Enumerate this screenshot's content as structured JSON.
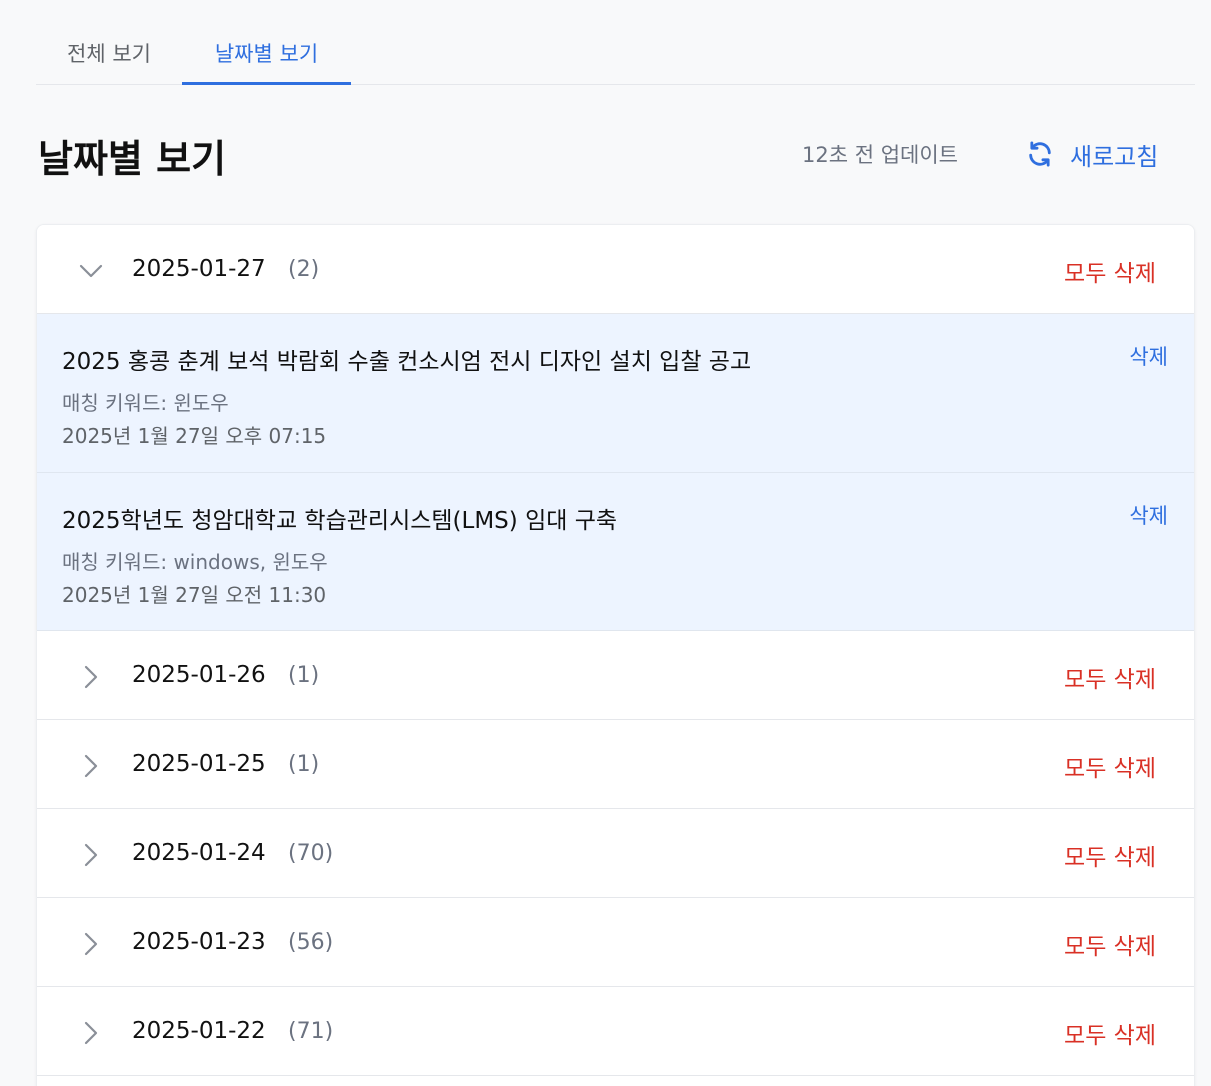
{
  "tabs": [
    {
      "label": "전체 보기",
      "active": false
    },
    {
      "label": "날짜별 보기",
      "active": true
    }
  ],
  "header": {
    "title": "날짜별 보기",
    "updated": "12초 전 업데이트",
    "refresh_label": "새로고침",
    "refresh_icon": "refresh-icon"
  },
  "colors": {
    "accent": "#2f6fdf",
    "danger": "#d93025",
    "expanded_bg": "#edf4ff"
  },
  "groups": [
    {
      "date": "2025-01-27",
      "count": "(2)",
      "delete_all": "모두 삭제",
      "expanded": true,
      "items": [
        {
          "title": "2025 홍콩 춘계 보석 박람회 수출 컨소시엄 전시 디자인 설치 입찰 공고",
          "keyword": "매칭 키워드: 윈도우",
          "time": "2025년 1월 27일 오후 07:15",
          "delete": "삭제"
        },
        {
          "title": "2025학년도 청암대학교 학습관리시스템(LMS) 임대 구축",
          "keyword": "매칭 키워드: windows, 윈도우",
          "time": "2025년 1월 27일 오전 11:30",
          "delete": "삭제"
        }
      ]
    },
    {
      "date": "2025-01-26",
      "count": "(1)",
      "delete_all": "모두 삭제",
      "expanded": false
    },
    {
      "date": "2025-01-25",
      "count": "(1)",
      "delete_all": "모두 삭제",
      "expanded": false
    },
    {
      "date": "2025-01-24",
      "count": "(70)",
      "delete_all": "모두 삭제",
      "expanded": false
    },
    {
      "date": "2025-01-23",
      "count": "(56)",
      "delete_all": "모두 삭제",
      "expanded": false
    },
    {
      "date": "2025-01-22",
      "count": "(71)",
      "delete_all": "모두 삭제",
      "expanded": false
    }
  ]
}
